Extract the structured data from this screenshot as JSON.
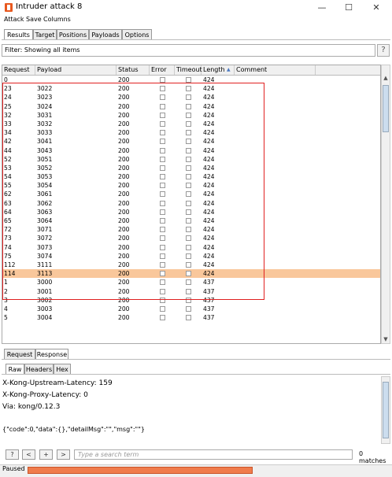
{
  "window": {
    "title": "Intruder attack 8",
    "min": "—",
    "max": "☐",
    "close": "✕"
  },
  "menu": [
    "Attack",
    "Save",
    "Columns"
  ],
  "tabs": [
    "Results",
    "Target",
    "Positions",
    "Payloads",
    "Options"
  ],
  "filter": {
    "text": "Filter: Showing all items",
    "help": "?"
  },
  "table": {
    "columns": [
      "Request",
      "Payload",
      "Status",
      "Error",
      "Timeout",
      "Length",
      "Comment"
    ],
    "sort_indicator": "▲",
    "rows": [
      [
        "0",
        "",
        "200",
        "424"
      ],
      [
        "23",
        "3022",
        "200",
        "424"
      ],
      [
        "24",
        "3023",
        "200",
        "424"
      ],
      [
        "25",
        "3024",
        "200",
        "424"
      ],
      [
        "32",
        "3031",
        "200",
        "424"
      ],
      [
        "33",
        "3032",
        "200",
        "424"
      ],
      [
        "34",
        "3033",
        "200",
        "424"
      ],
      [
        "42",
        "3041",
        "200",
        "424"
      ],
      [
        "44",
        "3043",
        "200",
        "424"
      ],
      [
        "52",
        "3051",
        "200",
        "424"
      ],
      [
        "53",
        "3052",
        "200",
        "424"
      ],
      [
        "54",
        "3053",
        "200",
        "424"
      ],
      [
        "55",
        "3054",
        "200",
        "424"
      ],
      [
        "62",
        "3061",
        "200",
        "424"
      ],
      [
        "63",
        "3062",
        "200",
        "424"
      ],
      [
        "64",
        "3063",
        "200",
        "424"
      ],
      [
        "65",
        "3064",
        "200",
        "424"
      ],
      [
        "72",
        "3071",
        "200",
        "424"
      ],
      [
        "73",
        "3072",
        "200",
        "424"
      ],
      [
        "74",
        "3073",
        "200",
        "424"
      ],
      [
        "75",
        "3074",
        "200",
        "424"
      ],
      [
        "112",
        "3111",
        "200",
        "424"
      ],
      [
        "114",
        "3113",
        "200",
        "424"
      ],
      [
        "1",
        "3000",
        "200",
        "437"
      ],
      [
        "2",
        "3001",
        "200",
        "437"
      ],
      [
        "3",
        "3002",
        "200",
        "437"
      ],
      [
        "4",
        "3003",
        "200",
        "437"
      ],
      [
        "5",
        "3004",
        "200",
        "437"
      ]
    ],
    "highlight_row_index": 22,
    "highlight_color": "#f9c79b"
  },
  "panel_tabs": [
    "Request",
    "Response"
  ],
  "view_tabs": [
    "Raw",
    "Headers",
    "Hex"
  ],
  "response_lines": [
    "X-Kong-Upstream-Latency: 159",
    "X-Kong-Proxy-Latency: 0",
    "Via: kong/0.12.3",
    "",
    "{\"code\":0,\"data\":{},\"detailMsg\":\"\",\"msg\":\"\"}"
  ],
  "search": {
    "placeholder": "Type a search term",
    "matches": "0 matches",
    "buttons": [
      "?",
      "<",
      "+",
      ">"
    ]
  },
  "status": {
    "text": "Paused",
    "progress_fraction": 0.57
  }
}
